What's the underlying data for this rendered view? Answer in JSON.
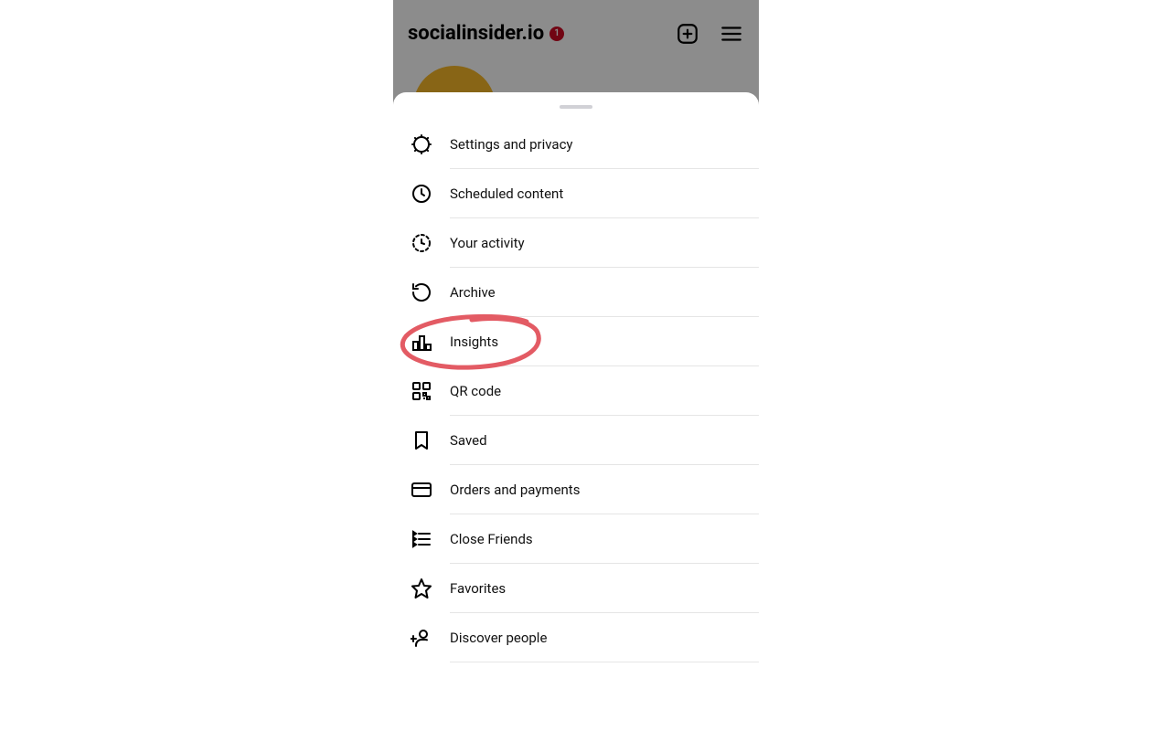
{
  "header": {
    "username": "socialinsider.io",
    "badge_count": "1"
  },
  "menu": {
    "items": [
      {
        "label": "Settings and privacy",
        "icon": "gear-icon"
      },
      {
        "label": "Scheduled content",
        "icon": "clock-icon"
      },
      {
        "label": "Your activity",
        "icon": "activity-icon"
      },
      {
        "label": "Archive",
        "icon": "archive-icon"
      },
      {
        "label": "Insights",
        "icon": "bar-chart-icon"
      },
      {
        "label": "QR code",
        "icon": "qr-code-icon"
      },
      {
        "label": "Saved",
        "icon": "bookmark-icon"
      },
      {
        "label": "Orders and payments",
        "icon": "credit-card-icon"
      },
      {
        "label": "Close Friends",
        "icon": "close-friends-icon"
      },
      {
        "label": "Favorites",
        "icon": "star-icon"
      },
      {
        "label": "Discover people",
        "icon": "add-person-icon"
      }
    ]
  },
  "annotation": {
    "highlighted_item_label": "Insights",
    "color": "#e35b64"
  }
}
